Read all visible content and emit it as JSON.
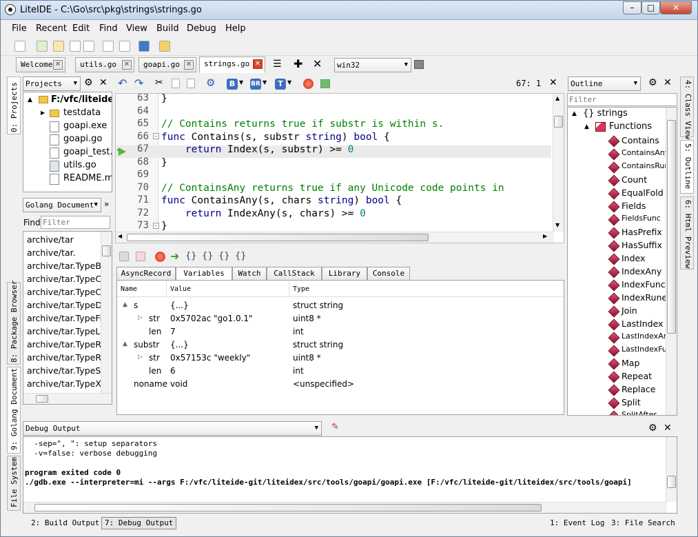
{
  "window": {
    "title": "LiteIDE - C:\\Go\\src\\pkg\\strings\\strings.go"
  },
  "menu": [
    "File",
    "Recent",
    "Edit",
    "Find",
    "View",
    "Build",
    "Debug",
    "Help"
  ],
  "tabs": [
    {
      "label": "Welcome"
    },
    {
      "label": "utils.go"
    },
    {
      "label": "goapi.go"
    },
    {
      "label": "strings.go"
    }
  ],
  "env_select": "win32",
  "left_strip": {
    "projects": "0: Projects",
    "package_browser": "8: Package Browser",
    "golang_document": "9: Golang Document",
    "file_system": "File System"
  },
  "right_strip": {
    "class_view": "4: Class View",
    "outline": "5: Outline",
    "html_preview": "6: Html Preview"
  },
  "projects": {
    "select": "Projects",
    "root": "F:/vfc/liteide-g",
    "items": [
      "testdata",
      "goapi.exe",
      "goapi.go",
      "goapi_test.g",
      "utils.go",
      "README.md"
    ]
  },
  "golang_doc": {
    "select": "Golang Document",
    "find_label": "Find",
    "filter_placeholder": "Filter",
    "items": [
      "archive/tar",
      "archive/tar.",
      "archive/tar.TypeBlo",
      "archive/tar.TypeCh",
      "archive/tar.TypeCo",
      "archive/tar.TypeDir",
      "archive/tar.TypeFifc",
      "archive/tar.TypeLin",
      "archive/tar.TypeReg",
      "archive/tar.TypeReg",
      "archive/tar.TypeSym",
      "archive/tar.TypeXG"
    ]
  },
  "editor": {
    "position": "67:  1",
    "lines": [
      {
        "n": "63",
        "html": "}"
      },
      {
        "n": "64",
        "html": ""
      },
      {
        "n": "65",
        "html": "<span class=\"cm\">// Contains returns true if substr is within s.</span>"
      },
      {
        "n": "66",
        "html": "<span class=\"kw\">func</span> Contains(s, substr <span class=\"kw\">string</span>) <span class=\"kw\">bool</span> {"
      },
      {
        "n": "67",
        "html": "    <span class=\"kw\">return</span> Index(s, substr) &gt;= <span class=\"num\">0</span>"
      },
      {
        "n": "68",
        "html": "}"
      },
      {
        "n": "69",
        "html": ""
      },
      {
        "n": "70",
        "html": "<span class=\"cm\">// ContainsAny returns true if any Unicode code points in</span>"
      },
      {
        "n": "71",
        "html": "<span class=\"kw\">func</span> ContainsAny(s, chars <span class=\"kw\">string</span>) <span class=\"kw\">bool</span> {"
      },
      {
        "n": "72",
        "html": "    <span class=\"kw\">return</span> IndexAny(s, chars) &gt;= <span class=\"num\">0</span>"
      },
      {
        "n": "73",
        "html": "}"
      }
    ]
  },
  "debug_tabs": [
    "AsyncRecord",
    "Variables",
    "Watch",
    "CallStack",
    "Library",
    "Console"
  ],
  "variables": {
    "headers": [
      "Name",
      "Value",
      "Type"
    ],
    "rows": [
      {
        "indent": 0,
        "exp": "▲",
        "name": "s",
        "value": "{...}",
        "type": "struct string"
      },
      {
        "indent": 1,
        "exp": "▷",
        "name": "str",
        "value": "0x5702ac \"go1.0.1\"",
        "type": "uint8 *"
      },
      {
        "indent": 1,
        "exp": "",
        "name": "len",
        "value": "7",
        "type": "int"
      },
      {
        "indent": 0,
        "exp": "▲",
        "name": "substr",
        "value": "{...}",
        "type": "struct string"
      },
      {
        "indent": 1,
        "exp": "▷",
        "name": "str",
        "value": "0x57153c \"weekly\"",
        "type": "uint8 *"
      },
      {
        "indent": 1,
        "exp": "",
        "name": "len",
        "value": "6",
        "type": "int"
      },
      {
        "indent": 0,
        "exp": "",
        "name": "noname",
        "value": "void",
        "type": "<unspecified>"
      }
    ]
  },
  "outline": {
    "select": "Outline",
    "filter_placeholder": "Filter",
    "pkg": "{} strings",
    "group": "Functions",
    "items": [
      "Contains",
      "ContainsAny",
      "ContainsRun",
      "Count",
      "EqualFold",
      "Fields",
      "FieldsFunc",
      "HasPrefix",
      "HasSuffix",
      "Index",
      "IndexAny",
      "IndexFunc",
      "IndexRune",
      "Join",
      "LastIndex",
      "LastIndexAr",
      "LastIndexFu",
      "Map",
      "Repeat",
      "Replace",
      "Split",
      "SplitAfter"
    ]
  },
  "output": {
    "select": "Debug Output",
    "lines": [
      {
        "t": "  -sep=\", \": setup separators",
        "b": false
      },
      {
        "t": "  -v=false: verbose debugging",
        "b": false
      },
      {
        "t": "",
        "b": false
      },
      {
        "t": "program exited code 0",
        "b": true
      },
      {
        "t": "./gdb.exe --interpreter=mi --args F:/vfc/liteide-git/liteidex/src/tools/goapi/goapi.exe [F:/vfc/liteide-git/liteidex/src/tools/goapi]",
        "b": true
      }
    ]
  },
  "status": {
    "build_output": "2: Build Output",
    "debug_output": "7: Debug Output",
    "event_log": "1: Event Log",
    "file_search": "3: File Search"
  }
}
